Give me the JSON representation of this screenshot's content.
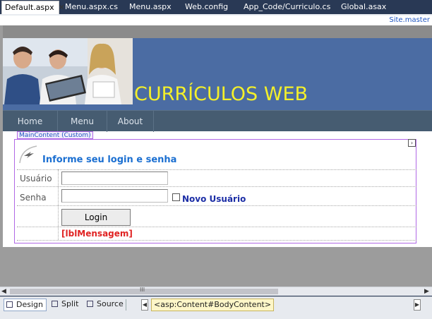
{
  "tabs": [
    {
      "label": "Default.aspx",
      "active": true,
      "close": "✕"
    },
    {
      "label": "Menu.aspx.cs",
      "active": false
    },
    {
      "label": "Menu.aspx",
      "active": false
    },
    {
      "label": "Web.config",
      "active": false
    },
    {
      "label": "App_Code/Curriculo.cs",
      "active": false
    },
    {
      "label": "Global.asax",
      "active": false
    }
  ],
  "designer": {
    "master_page": "Site.master",
    "site_title": "CURRÍCULOS WEB",
    "menu": [
      "Home",
      "Menu",
      "About"
    ],
    "content_placeholder": "MainContent (Custom)",
    "smart_tag": "›",
    "login": {
      "heading": "Informe seu login e senha",
      "user_label": "Usuário",
      "password_label": "Senha",
      "new_user_link": "Novo Usuário",
      "login_button": "Login",
      "message_label": "[lblMensagem]"
    }
  },
  "scrollbar": {
    "left": "◀",
    "right": "▶",
    "grip": "III"
  },
  "viewbar": {
    "design": "Design",
    "split": "Split",
    "source": "Source",
    "breadcrumb": "<asp:Content#BodyContent>",
    "left_arrow": "◀",
    "right_arrow": "▶"
  },
  "colors": {
    "banner": "#4b6ca3",
    "title": "#f4f02a",
    "menubar": "#465c71",
    "placeholder_border": "#b168e6",
    "heading": "#1b6fd1",
    "error": "#e02222"
  }
}
